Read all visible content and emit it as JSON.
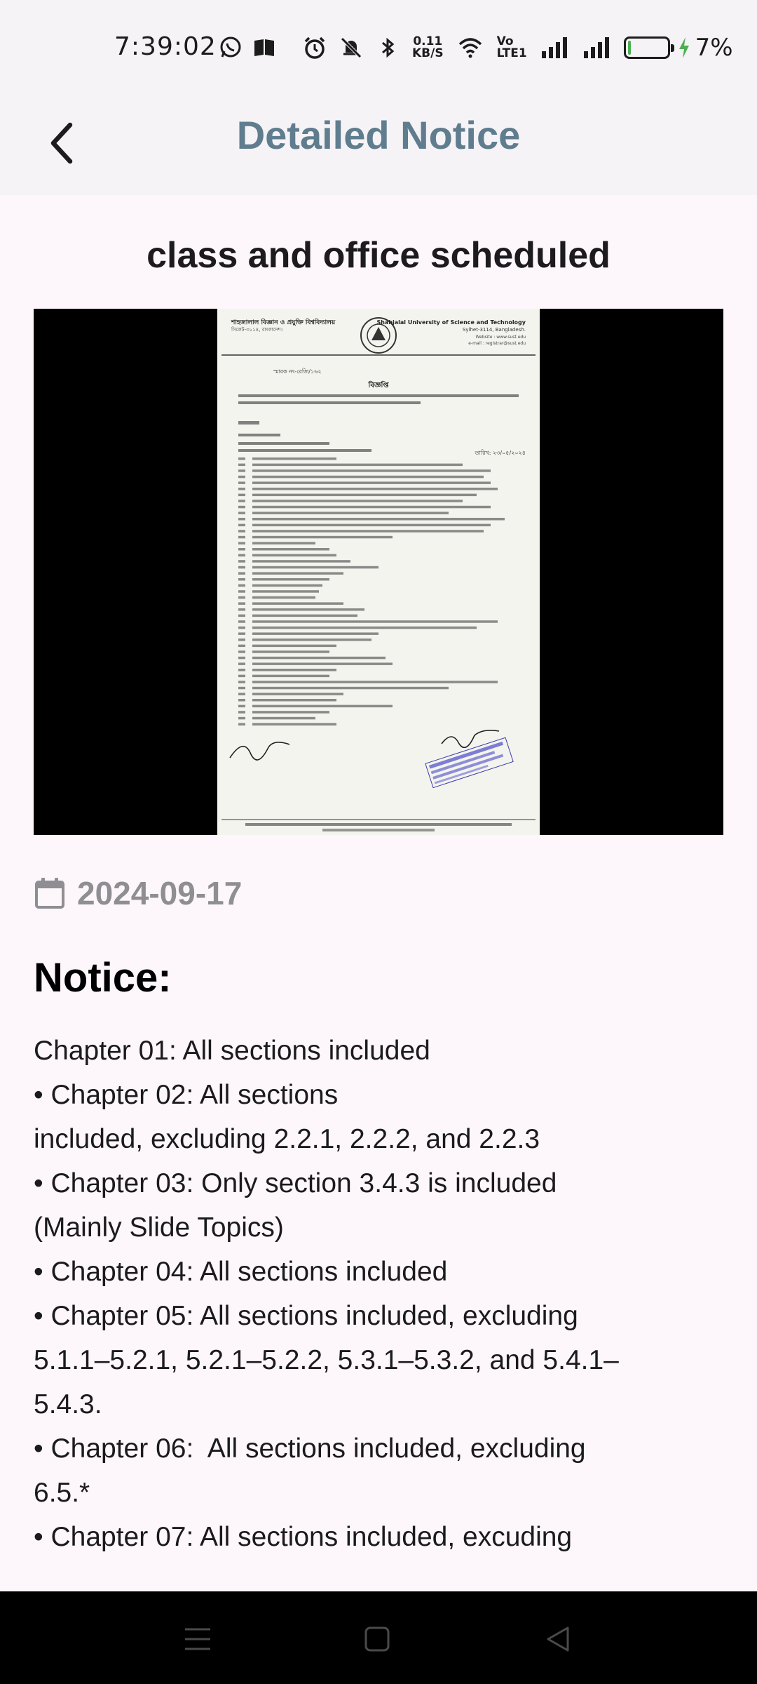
{
  "status_bar": {
    "time": "7:39:02",
    "net_speed_value": "0.11",
    "net_speed_unit": "KB/S",
    "volte_top": "Vo",
    "volte_bottom": "LTE1",
    "battery_percent": "7%",
    "battery_level": 0.07,
    "battery_fill_color": "#4caf50",
    "charging_color": "#4caf50"
  },
  "app_bar": {
    "title": "Detailed Notice",
    "title_color": "#5f7d8e"
  },
  "notice": {
    "title": "class and office scheduled",
    "date": "2024-09-17",
    "label": "Notice:",
    "body_lines": [
      "Chapter 01: All sections included",
      "• Chapter 02: All sections",
      "included, excluding 2.2.1, 2.2.2, and 2.2.3",
      "• Chapter 03: Only section 3.4.3 is included",
      "(Mainly Slide Topics)",
      "• Chapter 04: All sections included",
      "• Chapter 05: All sections included, excluding",
      "5.1.1–5.2.1, 5.2.1–5.2.2, 5.3.1–5.3.2, and 5.4.1–",
      "5.4.3.",
      "• Chapter 06:  All sections included, excluding",
      "6.5.*",
      "• Chapter 07: All sections included, excuding"
    ]
  },
  "document_image": {
    "header_left_line1": "শাহজালাল বিজ্ঞান ও প্রযুক্তি বিশ্ববিদ্যালয়",
    "header_left_line2": "সিলেট-৩১১৪, বাংলাদেশ।",
    "header_right_line1": "Shahjalal University of Science and Technology",
    "header_right_line2": "Sylhet-3114, Bangladesh.",
    "header_right_line3": "Website : www.sust.edu",
    "header_right_line4": "e-mail : registrar@sust.edu",
    "ref_line": "স্মারক নং-রেজি/১৬২",
    "heading": "বিজ্ঞপ্তি",
    "date_line": "তারিখ: ২৩/০৫/২০২৪"
  },
  "nav_bar": {
    "recents": "menu-icon",
    "home": "square-icon",
    "back": "triangle-back-icon"
  }
}
